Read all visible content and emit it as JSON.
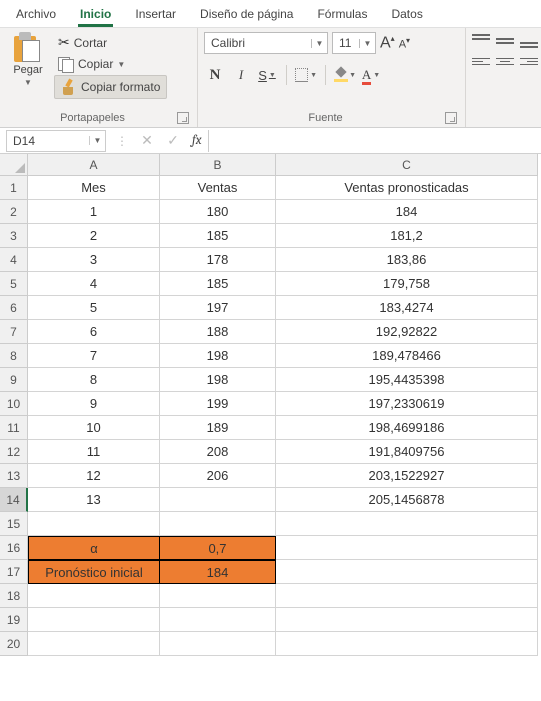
{
  "chart_data": {
    "type": "table",
    "columns": [
      "Mes",
      "Ventas",
      "Ventas pronosticadas"
    ],
    "rows": [
      [
        1,
        180,
        184
      ],
      [
        2,
        185,
        181.2
      ],
      [
        3,
        178,
        183.86
      ],
      [
        4,
        185,
        179.758
      ],
      [
        5,
        197,
        183.4274
      ],
      [
        6,
        188,
        192.92822
      ],
      [
        7,
        198,
        189.478466
      ],
      [
        8,
        198,
        195.4435398
      ],
      [
        9,
        199,
        197.2330619
      ],
      [
        10,
        189,
        198.4699186
      ],
      [
        11,
        208,
        191.8409756
      ],
      [
        12,
        206,
        203.1522927
      ],
      [
        13,
        null,
        205.1456878
      ]
    ],
    "parameters": {
      "alpha": 0.7,
      "pronostico_inicial": 184
    }
  },
  "menu": {
    "archivo": "Archivo",
    "inicio": "Inicio",
    "insertar": "Insertar",
    "diseno": "Diseño de página",
    "formulas": "Fórmulas",
    "datos": "Datos"
  },
  "ribbon": {
    "paste": "Pegar",
    "cut": "Cortar",
    "copy": "Copiar",
    "format_painter": "Copiar formato",
    "clipboard_label": "Portapapeles",
    "font_name": "Calibri",
    "font_size": "11",
    "bold": "N",
    "italic": "I",
    "underline": "S",
    "font_color_letter": "A",
    "big_a": "A",
    "small_a": "A",
    "font_label": "Fuente"
  },
  "fx": {
    "namebox": "D14",
    "fx_label": "fx",
    "value": ""
  },
  "cols": {
    "A": "A",
    "B": "B",
    "C": "C"
  },
  "headers": {
    "mes": "Mes",
    "ventas": "Ventas",
    "pron": "Ventas pronosticadas"
  },
  "rows": {
    "r2": {
      "a": "1",
      "b": "180",
      "c": "184"
    },
    "r3": {
      "a": "2",
      "b": "185",
      "c": "181,2"
    },
    "r4": {
      "a": "3",
      "b": "178",
      "c": "183,86"
    },
    "r5": {
      "a": "4",
      "b": "185",
      "c": "179,758"
    },
    "r6": {
      "a": "5",
      "b": "197",
      "c": "183,4274"
    },
    "r7": {
      "a": "6",
      "b": "188",
      "c": "192,92822"
    },
    "r8": {
      "a": "7",
      "b": "198",
      "c": "189,478466"
    },
    "r9": {
      "a": "8",
      "b": "198",
      "c": "195,4435398"
    },
    "r10": {
      "a": "9",
      "b": "199",
      "c": "197,2330619"
    },
    "r11": {
      "a": "10",
      "b": "189",
      "c": "198,4699186"
    },
    "r12": {
      "a": "11",
      "b": "208",
      "c": "191,8409756"
    },
    "r13": {
      "a": "12",
      "b": "206",
      "c": "203,1522927"
    },
    "r14": {
      "a": "13",
      "b": "",
      "c": "205,1456878"
    }
  },
  "params": {
    "alpha_label": "α",
    "alpha_val": "0,7",
    "init_label": "Pronóstico inicial",
    "init_val": "184"
  },
  "rownums": {
    "1": "1",
    "2": "2",
    "3": "3",
    "4": "4",
    "5": "5",
    "6": "6",
    "7": "7",
    "8": "8",
    "9": "9",
    "10": "10",
    "11": "11",
    "12": "12",
    "13": "13",
    "14": "14",
    "15": "15",
    "16": "16",
    "17": "17",
    "18": "18",
    "19": "19",
    "20": "20"
  }
}
